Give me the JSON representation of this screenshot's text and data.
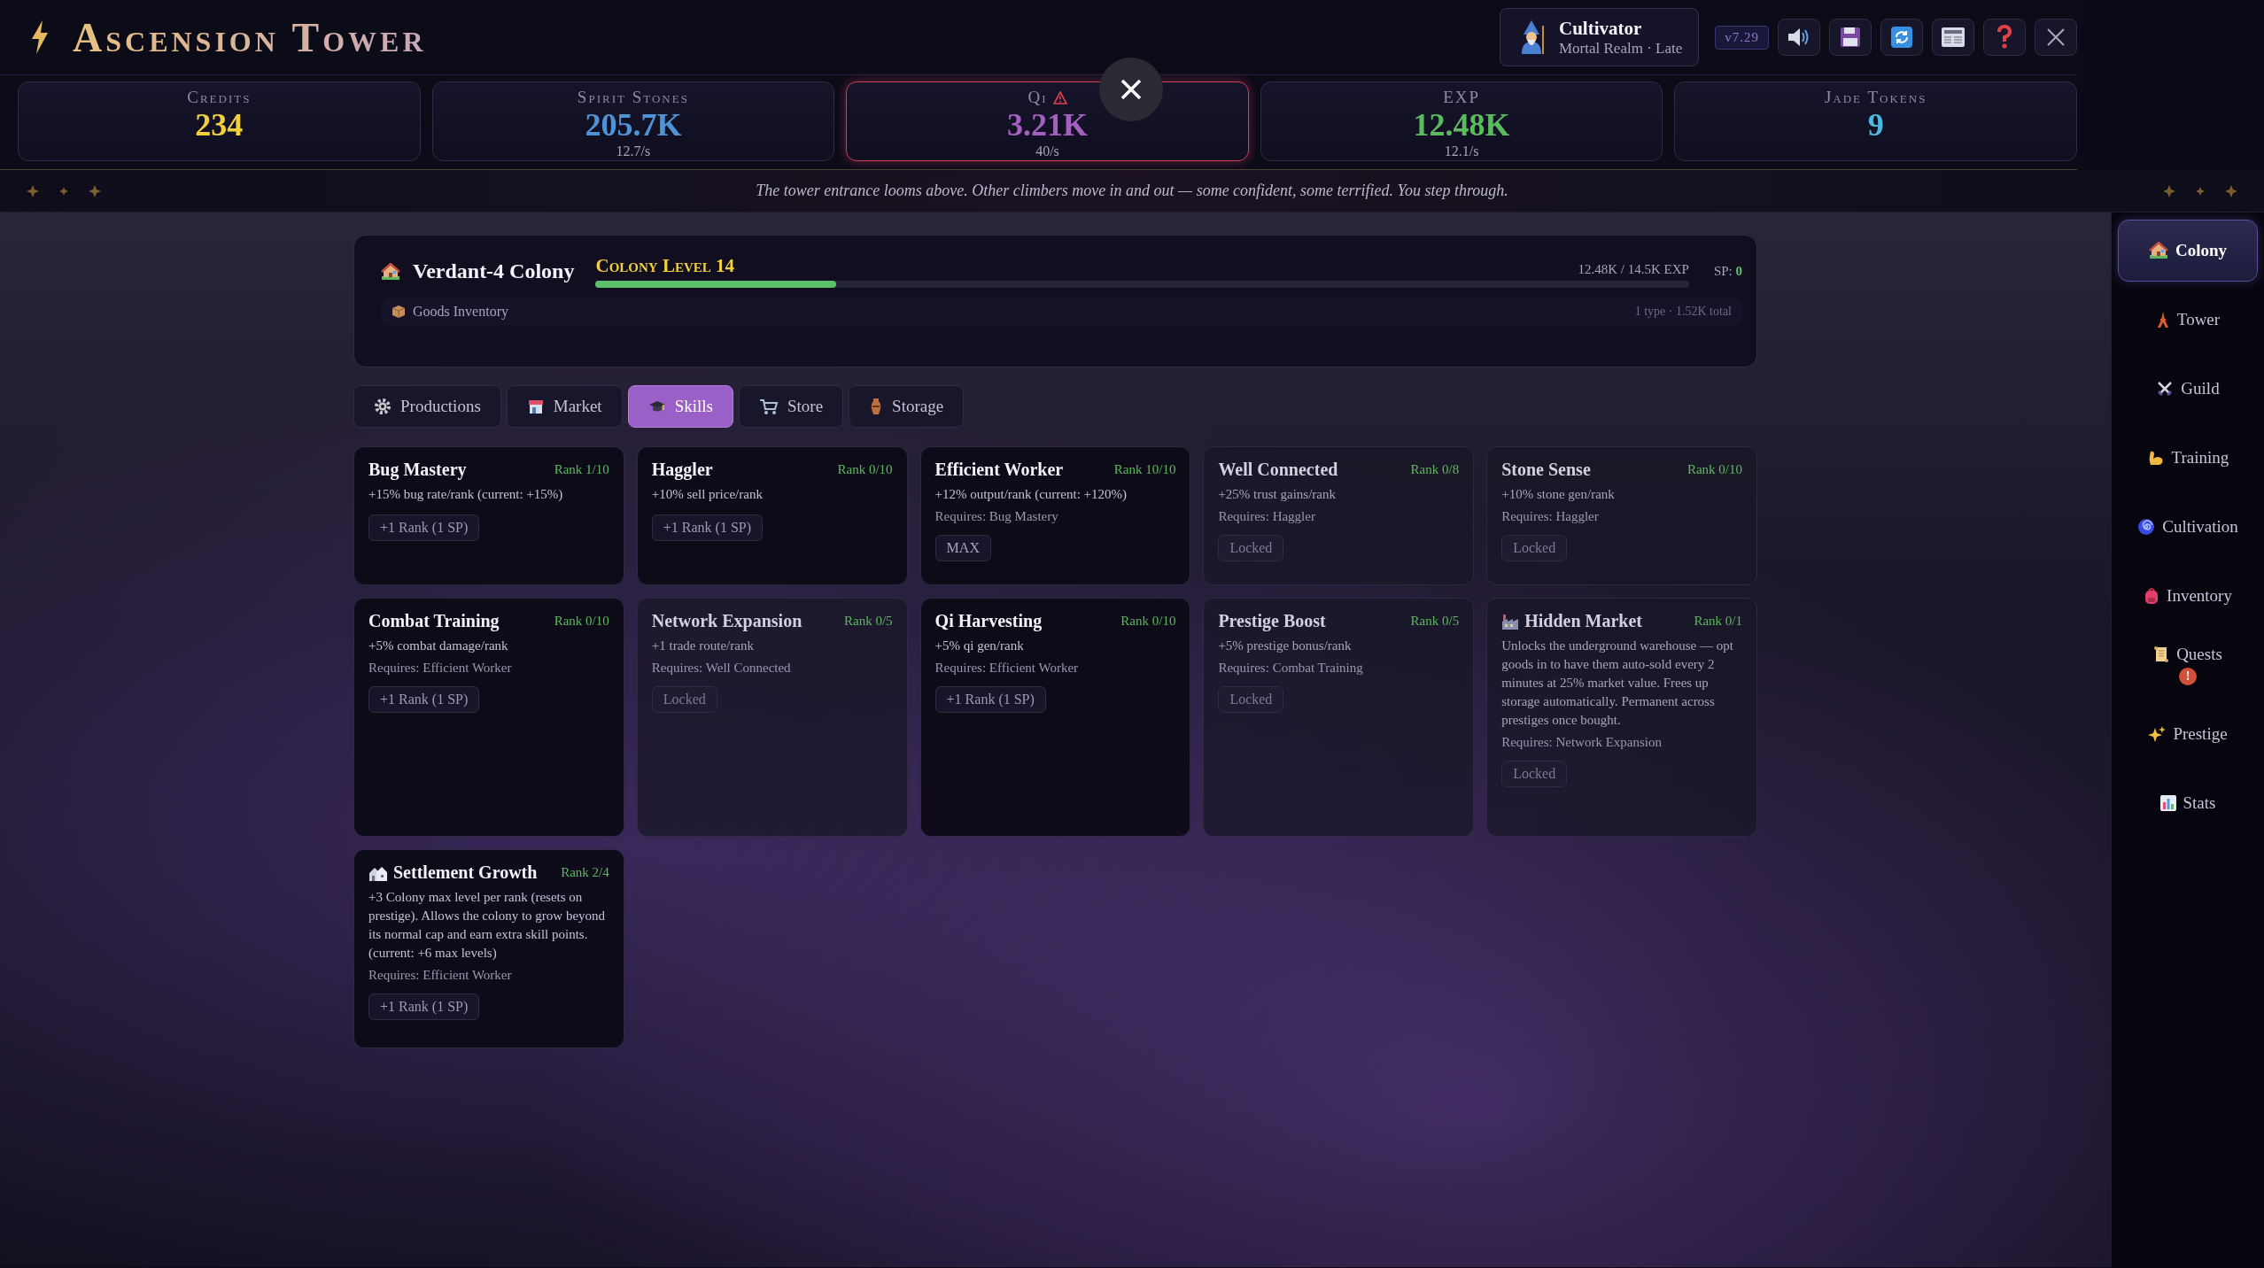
{
  "header": {
    "title": "Ascension Tower",
    "profile": {
      "name": "Cultivator",
      "realm": "Mortal Realm · Late"
    },
    "version": "v7.29"
  },
  "stats": [
    {
      "label": "Credits",
      "value": "234",
      "color": "#f2cf3c",
      "warning": false
    },
    {
      "label": "Spirit Stones",
      "value": "205.7K",
      "rate": "12.7/s",
      "color": "#4f93d6",
      "warning": false
    },
    {
      "label": "Qi",
      "value": "3.21K",
      "rate": "40/s",
      "color": "#a45fc0",
      "warning": true
    },
    {
      "label": "EXP",
      "value": "12.48K",
      "rate": "12.1/s",
      "color": "#5cba5e",
      "warning": false
    },
    {
      "label": "Jade Tokens",
      "value": "9",
      "color": "#4fb8e0",
      "warning": false
    }
  ],
  "narrative": "The tower entrance looms above. Other climbers move in and out — some confident, some terrified. You step through.",
  "colony": {
    "name": "Verdant-4 Colony",
    "level_label": "Colony Level 14",
    "level": 0.22,
    "exp": "12.48K / 14.5K EXP",
    "sp_label": "SP:",
    "sp_value": "0",
    "goods_label": "Goods Inventory",
    "goods_summary": "1 type · 1.52K total"
  },
  "tabs": [
    {
      "label": "Productions",
      "selected": false
    },
    {
      "label": "Market",
      "selected": false
    },
    {
      "label": "Skills",
      "selected": true
    },
    {
      "label": "Store",
      "selected": false
    },
    {
      "label": "Storage",
      "selected": false
    }
  ],
  "skills": [
    {
      "name": "Bug Mastery",
      "rank": "Rank 1/10",
      "description": "+15% bug rate/rank (current: +15%)",
      "action": "+1 Rank (1 SP)",
      "kind": "available"
    },
    {
      "name": "Haggler",
      "rank": "Rank 0/10",
      "description": "+10% sell price/rank",
      "action": "+1 Rank (1 SP)",
      "kind": "available"
    },
    {
      "name": "Efficient Worker",
      "rank": "Rank 10/10",
      "description": "+12% output/rank (current: +120%)",
      "requires": "Requires: Bug Mastery",
      "action": "MAX",
      "kind": "maxed"
    },
    {
      "name": "Well Connected",
      "rank": "Rank 0/8",
      "description": "+25% trust gains/rank",
      "requires": "Requires: Haggler",
      "action": "Locked",
      "kind": "locked"
    },
    {
      "name": "Stone Sense",
      "rank": "Rank 0/10",
      "description": "+10% stone gen/rank",
      "requires": "Requires: Haggler",
      "action": "Locked",
      "kind": "locked"
    },
    {
      "name": "Combat Training",
      "rank": "Rank 0/10",
      "description": "+5% combat damage/rank",
      "requires": "Requires: Efficient Worker",
      "action": "+1 Rank (1 SP)",
      "kind": "available"
    },
    {
      "name": "Network Expansion",
      "rank": "Rank 0/5",
      "description": "+1 trade route/rank",
      "requires": "Requires: Well Connected",
      "action": "Locked",
      "kind": "locked"
    },
    {
      "name": "Qi Harvesting",
      "rank": "Rank 0/10",
      "description": "+5% qi gen/rank",
      "requires": "Requires: Efficient Worker",
      "action": "+1 Rank (1 SP)",
      "kind": "available"
    },
    {
      "name": "Prestige Boost",
      "rank": "Rank 0/5",
      "description": "+5% prestige bonus/rank",
      "requires": "Requires: Combat Training",
      "action": "Locked",
      "kind": "locked"
    },
    {
      "name": "Hidden Market",
      "rank": "Rank 0/1",
      "description": "Unlocks the underground warehouse — opt goods in to have them auto-sold every 2 minutes at 25% market value. Frees up storage automatically. Permanent across prestiges once bought.",
      "requires": "Requires: Network Expansion",
      "action": "Locked",
      "kind": "locked"
    },
    {
      "name": "Settlement Growth",
      "rank": "Rank 2/4",
      "description": "+3 Colony max level per rank (resets on prestige). Allows the colony to grow beyond its normal cap and earn extra skill points. (current: +6 max levels)",
      "requires": "Requires: Efficient Worker",
      "action": "+1 Rank (1 SP)",
      "kind": "available"
    }
  ],
  "sidebar": {
    "items": [
      {
        "label": "Colony",
        "selected": true
      },
      {
        "label": "Tower",
        "selected": false
      },
      {
        "label": "Guild",
        "selected": false
      },
      {
        "label": "Training",
        "selected": false
      },
      {
        "label": "Cultivation",
        "selected": false
      },
      {
        "label": "Inventory",
        "selected": false
      },
      {
        "label": "Quests",
        "selected": false,
        "badge": "!"
      },
      {
        "label": "Prestige",
        "selected": false
      },
      {
        "label": "Stats",
        "selected": false
      }
    ]
  }
}
